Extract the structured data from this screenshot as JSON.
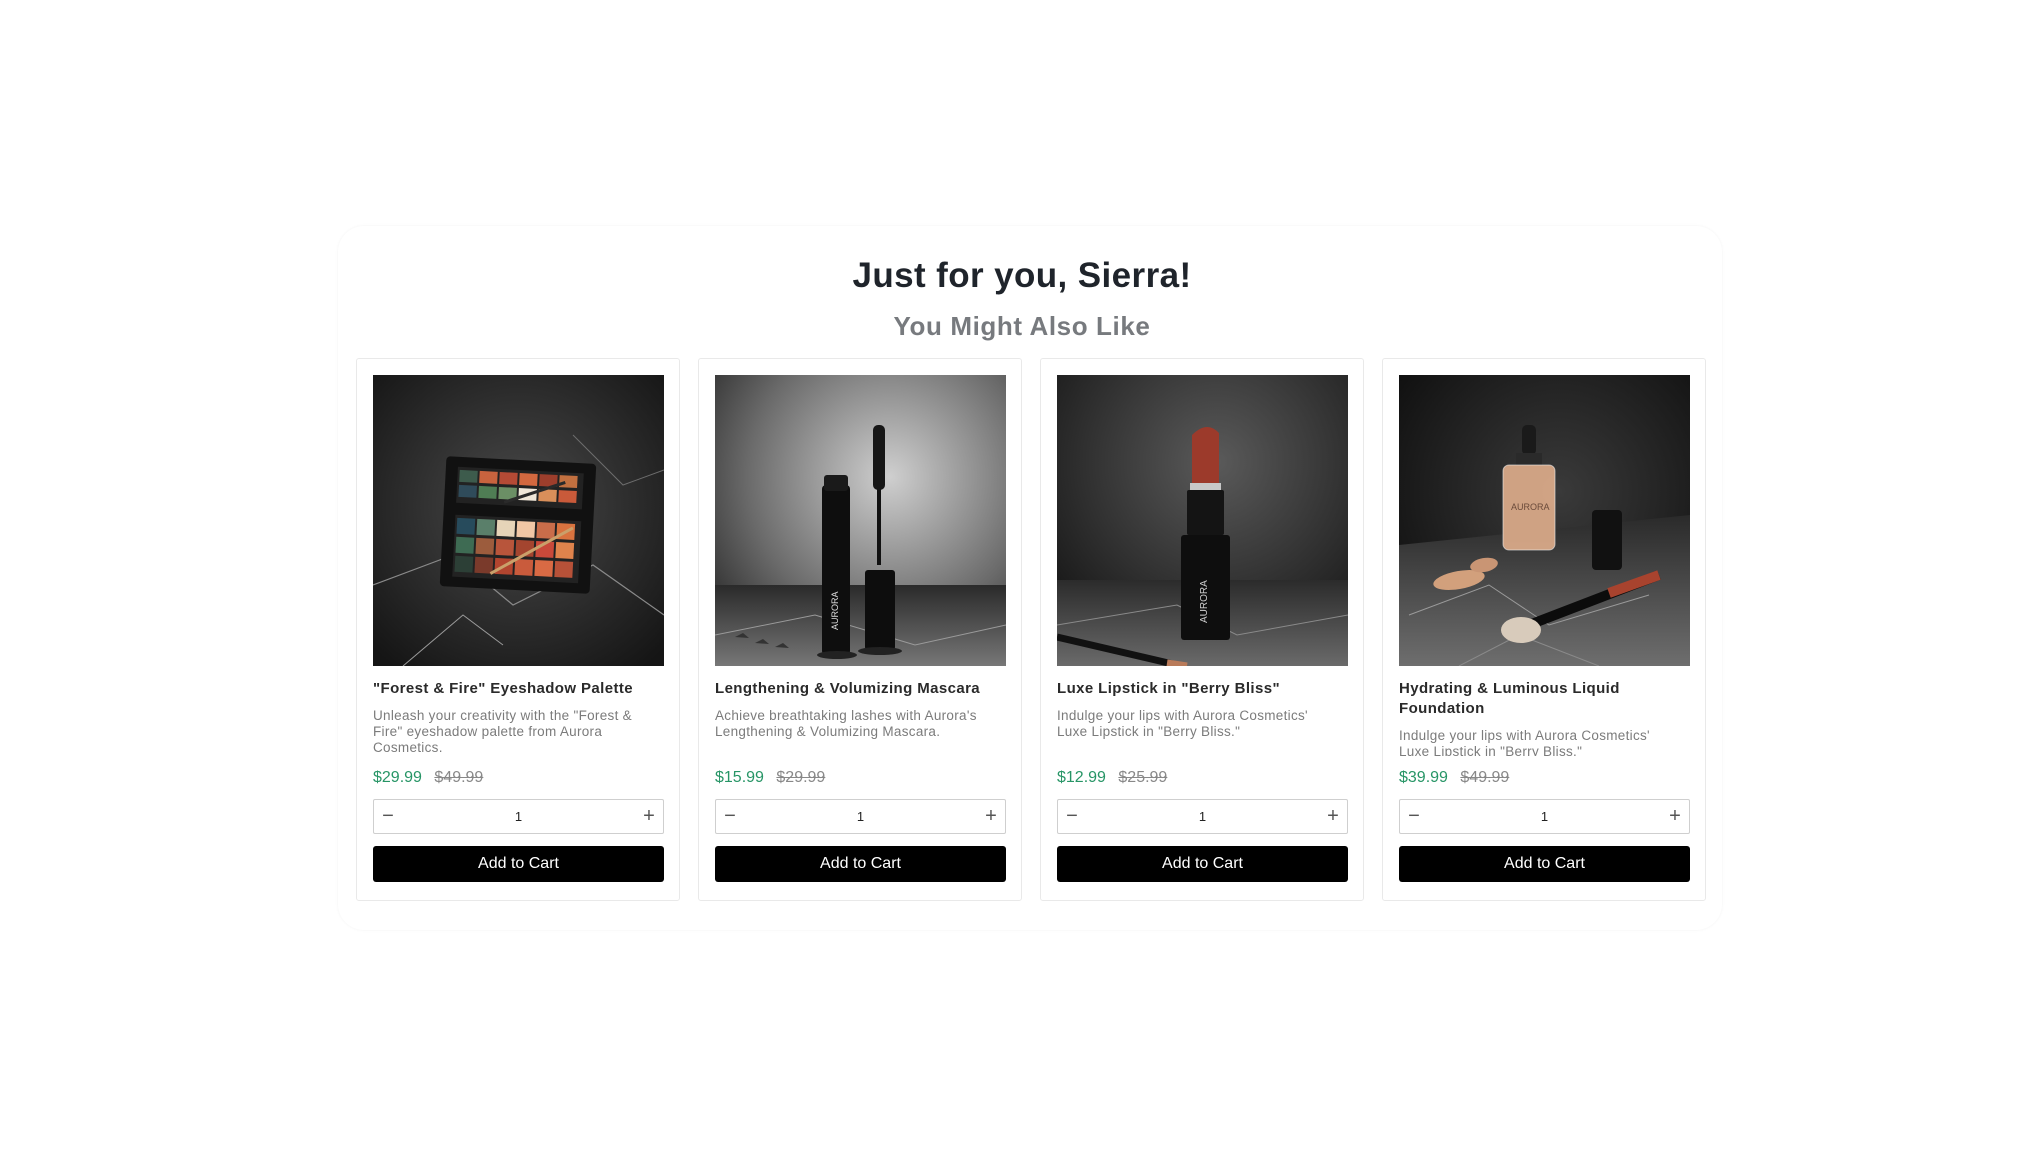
{
  "header": {
    "title": "Just for you, Sierra!",
    "subtitle": "You Might Also Like"
  },
  "colors": {
    "price": "#279566",
    "button": "#000000"
  },
  "products": [
    {
      "name": "\"Forest & Fire\" Eyeshadow Palette",
      "description": "Unleash your creativity with the \"Forest & Fire\" eyeshadow palette from Aurora Cosmetics.",
      "price": "$29.99",
      "old_price": "$49.99",
      "quantity": "1",
      "button": "Add to Cart",
      "image": "eyeshadow-palette-photo"
    },
    {
      "name": "Lengthening & Volumizing Mascara",
      "description": "Achieve breathtaking lashes with Aurora's Lengthening & Volumizing Mascara.",
      "price": "$15.99",
      "old_price": "$29.99",
      "quantity": "1",
      "button": "Add to Cart",
      "image": "mascara-photo"
    },
    {
      "name": "Luxe Lipstick in \"Berry Bliss\"",
      "description": "Indulge your lips with Aurora Cosmetics' Luxe Lipstick in \"Berry Bliss.\"",
      "price": "$12.99",
      "old_price": "$25.99",
      "quantity": "1",
      "button": "Add to Cart",
      "image": "lipstick-photo"
    },
    {
      "name": "Hydrating & Luminous Liquid Foundation",
      "description": "Indulge your lips with Aurora Cosmetics' Luxe Lipstick in \"Berry Bliss.\"",
      "price": "$39.99",
      "old_price": "$49.99",
      "quantity": "1",
      "button": "Add to Cart",
      "image": "foundation-photo"
    }
  ]
}
